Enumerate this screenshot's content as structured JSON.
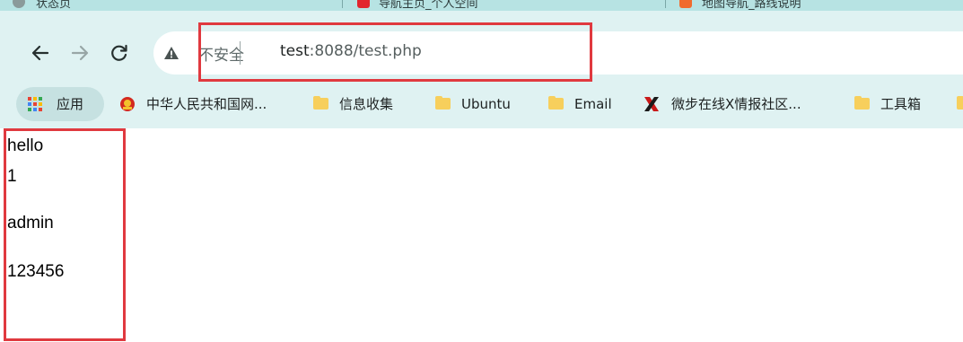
{
  "tabs": {
    "items": [
      {
        "label": "状态页",
        "icon": "globe-icon"
      },
      {
        "label": "导航主页_个人空间",
        "icon": "app-icon"
      },
      {
        "label": "地图导航_路线说明",
        "icon": "map-icon"
      }
    ]
  },
  "toolbar": {
    "back_icon": "back-arrow-icon",
    "forward_icon": "forward-arrow-icon",
    "reload_icon": "reload-icon",
    "security_label": "不安全",
    "url_host": "test",
    "url_rest": ":8088/test.php"
  },
  "bookmarks": {
    "apps_label": "应用",
    "items": [
      {
        "label": "中华人民共和国网...",
        "icon": "emblem-icon"
      },
      {
        "label": "信息收集",
        "icon": "folder-icon"
      },
      {
        "label": "Ubuntu",
        "icon": "folder-icon"
      },
      {
        "label": "Email",
        "icon": "folder-icon"
      },
      {
        "label": "微步在线X情报社区...",
        "icon": "x-logo-icon"
      },
      {
        "label": "工具箱",
        "icon": "folder-icon"
      }
    ]
  },
  "page": {
    "lines": [
      "hello",
      "1",
      "admin",
      "123456"
    ]
  },
  "colors": {
    "annotation": "#e0393f",
    "toolbar_bg": "#dff2f2",
    "folder": "#f7cf5c"
  }
}
